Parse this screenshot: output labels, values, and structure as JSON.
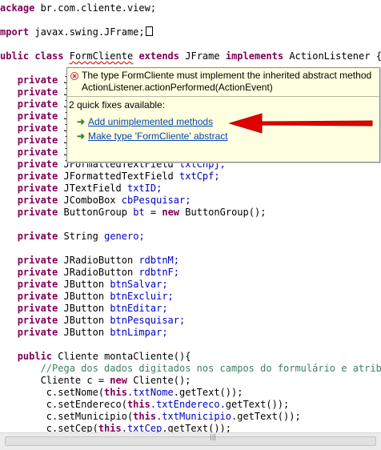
{
  "editor": {
    "lines": {
      "l1": {
        "kw": "ackage",
        "rest": " br.com.cliente.view;"
      },
      "l2": {
        "kw": "mport",
        "rest": " javax.swing.JFrame;"
      },
      "l3": {
        "kw1": "ublic",
        "kw2": "class",
        "name": "FormCliente",
        "kw3": "extends",
        "mid": "JFrame",
        "kw4": "implements",
        "tail": "ActionListener {"
      },
      "private_kw": "private",
      "partial_type": "J",
      "f1": {
        "type": "JFormattedTextField",
        "name": "txtCnpj;"
      },
      "f2": {
        "type": "JFormattedTextField",
        "name": "txtCpf;"
      },
      "f3": {
        "type": "JTextField",
        "name": "txtID;"
      },
      "f4": {
        "type": "JComboBox",
        "name": "cbPesquisar;"
      },
      "f5": {
        "type": "ButtonGroup",
        "name": "bt",
        "eq": " = ",
        "new": "new",
        "ctor": " ButtonGroup();"
      },
      "f6": {
        "type": "String",
        "name": "genero;"
      },
      "f7": {
        "type": "JRadioButton",
        "name": "rdbtnM;"
      },
      "f8": {
        "type": "JRadioButton",
        "name": "rdbtnF;"
      },
      "f9": {
        "type": "JButton",
        "name": "btnSalvar;"
      },
      "f10": {
        "type": "JButton",
        "name": "btnExcluir;"
      },
      "f11": {
        "type": "JButton",
        "name": "btnEditar;"
      },
      "f12": {
        "type": "JButton",
        "name": "btnPesquisar;"
      },
      "f13": {
        "type": "JButton",
        "name": "btnLimpar;"
      },
      "m1": {
        "kw": "public",
        "rest": " Cliente montaCliente(){"
      },
      "m2": {
        "comment": "//Pega dos dados digitados nos campos do formulário e atribui"
      },
      "m3": {
        "pre": "Cliente c = ",
        "kw": "new",
        "rest": " Cliente();"
      },
      "m4": {
        "pre": "c.setNome(",
        "kw": "this",
        "fld": ".txtNome",
        "rest": ".getText());"
      },
      "m5": {
        "pre": "c.setEndereco(",
        "kw": "this",
        "fld": ".txtEndereco",
        "rest": ".getText());"
      },
      "m6": {
        "pre": "c.setMunicipio(",
        "kw": "this",
        "fld": ".txtMunicipio",
        "rest": ".getText());"
      },
      "m7": {
        "pre": "c.setCep(",
        "kw": "this",
        "fld": ".txtCep",
        "rest": ".getText());"
      }
    }
  },
  "popup": {
    "message_line1": "The type FormCliente must implement the inherited abstract method",
    "message_line2": "ActionListener.actionPerformed(ActionEvent)",
    "quick_fix_count": "2 quick fixes available:",
    "fixes": [
      {
        "label": "Add unimplemented methods",
        "icon": "green-arrow-icon"
      },
      {
        "label": "Make type 'FormCliente' abstract",
        "icon": "green-arrow-icon"
      }
    ]
  },
  "colors": {
    "keyword": "#7f0055",
    "field": "#0000c0",
    "comment": "#3f7f5f",
    "popup_bg": "#ffffe1",
    "annotation_arrow": "#e00000",
    "link": "#0645ad"
  },
  "icons": [
    "error-icon",
    "green-arrow-icon",
    "red-annotation-arrow"
  ]
}
